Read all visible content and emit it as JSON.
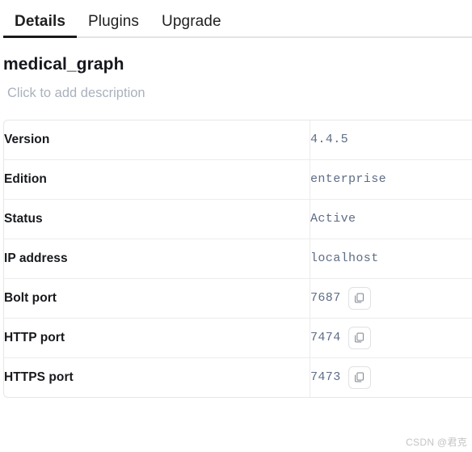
{
  "tabs": [
    {
      "label": "Details",
      "active": true
    },
    {
      "label": "Plugins",
      "active": false
    },
    {
      "label": "Upgrade",
      "active": false
    }
  ],
  "database": {
    "name": "medical_graph",
    "description_placeholder": "Click to add description"
  },
  "details_table": {
    "rows": [
      {
        "label": "Version",
        "value": "4.4.5",
        "copyable": false
      },
      {
        "label": "Edition",
        "value": "enterprise",
        "copyable": false
      },
      {
        "label": "Status",
        "value": "Active",
        "copyable": false
      },
      {
        "label": "IP address",
        "value": "localhost",
        "copyable": false
      },
      {
        "label": "Bolt port",
        "value": "7687",
        "copyable": true
      },
      {
        "label": "HTTP port",
        "value": "7474",
        "copyable": true
      },
      {
        "label": "HTTPS port",
        "value": "7473",
        "copyable": true
      }
    ],
    "copy_icon": "copy-icon"
  },
  "watermark": {
    "text": "CSDN @君克"
  },
  "colors": {
    "active_tab_underline": "#1a1a1a",
    "label_text": "#17191d",
    "value_text": "#5d6c85",
    "placeholder_text": "#a9b1bd",
    "border": "#e6e7e9"
  }
}
